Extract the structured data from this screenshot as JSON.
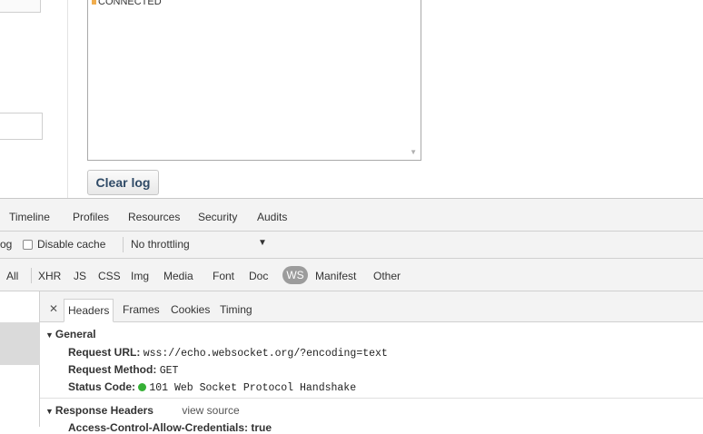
{
  "log": {
    "entries": [
      "CONNECTED"
    ],
    "status_color": "#f0ad4e",
    "clear_label": "Clear log"
  },
  "devtools": {
    "main_tabs": [
      "Timeline",
      "Profiles",
      "Resources",
      "Security",
      "Audits"
    ],
    "toolbar": {
      "preserve_log_partial": "og",
      "disable_cache_label": "Disable cache",
      "throttle_value": "No throttling"
    },
    "filters": [
      "All",
      "XHR",
      "JS",
      "CSS",
      "Img",
      "Media",
      "Font",
      "Doc",
      "WS",
      "Manifest",
      "Other"
    ],
    "active_filter": "WS",
    "detail_tabs": [
      "Headers",
      "Frames",
      "Cookies",
      "Timing"
    ],
    "active_detail_tab": "Headers",
    "general": {
      "title": "General",
      "request_url_label": "Request URL:",
      "request_url": "wss://echo.websocket.org/?encoding=text",
      "request_method_label": "Request Method:",
      "request_method": "GET",
      "status_code_label": "Status Code:",
      "status_code": "101 Web Socket Protocol Handshake",
      "status_color": "#35b035"
    },
    "response_headers": {
      "title": "Response Headers",
      "view_source": "view source",
      "first_row_partial": "Access-Control-Allow-Credentials: true"
    }
  }
}
